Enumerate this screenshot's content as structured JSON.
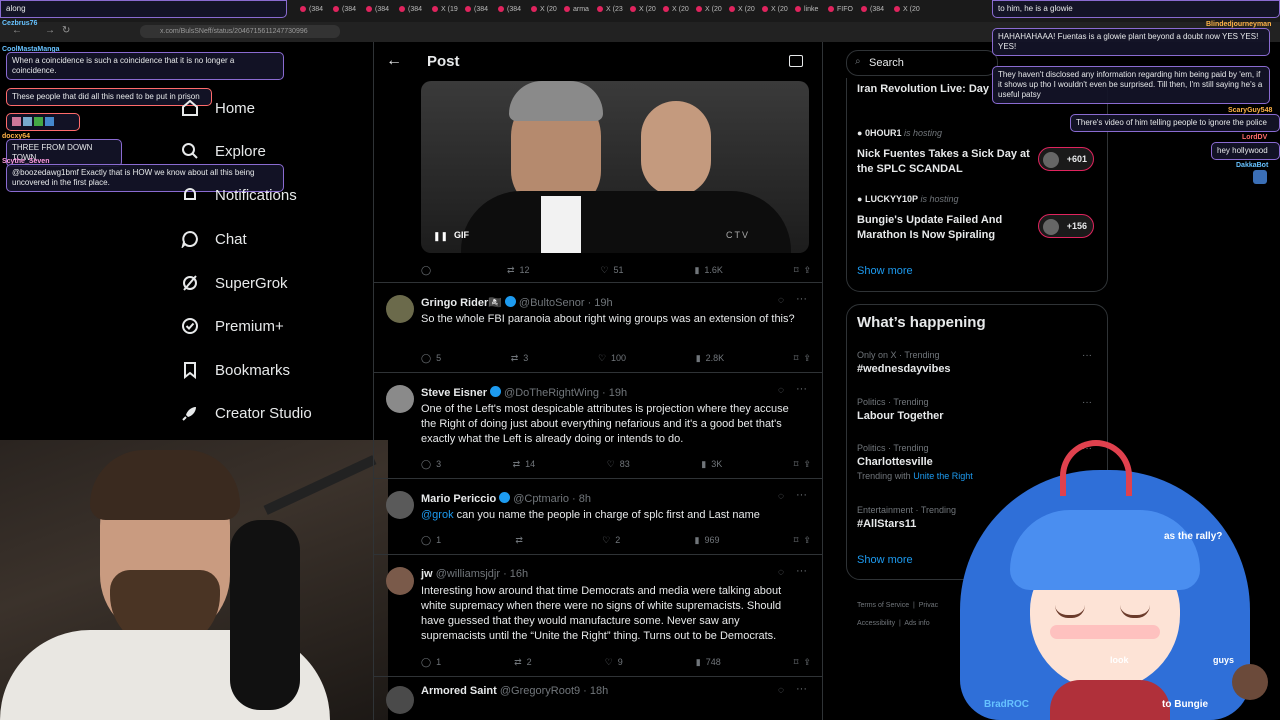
{
  "browser": {
    "url": "x.com/BulsSNeff/status/2046715611247730996",
    "tabs": [
      "(384",
      "(384",
      "(384",
      "(384",
      "X (19",
      "(384",
      "(384",
      "X (20",
      "arma",
      "X (23",
      "X (20",
      "X (20",
      "X (20",
      "X (20",
      "X (20",
      "linke",
      "FIFO",
      "(384",
      "X (20"
    ]
  },
  "chat_left": [
    {
      "user": "",
      "text": "along",
      "color": "#fff"
    },
    {
      "user": "Cezbrus76",
      "text": "",
      "color": "#66c2ff"
    },
    {
      "user": "CoolMastaManga",
      "text": "When a coincidence is such a coincidence that it is no longer a coincidence.",
      "color": "#66c2ff"
    },
    {
      "user": "",
      "text": "These people that did all this need to be put in prison",
      "color": "#ff6b6b"
    },
    {
      "user": "",
      "text": "",
      "color": "#ff6b6b"
    },
    {
      "user": "docxy64",
      "text": "THREE FROM DOWN TOWN",
      "color": "#ffb347"
    },
    {
      "user": "Scythe_Seven",
      "text": "@boozedawg1bmf Exactly that is HOW we know about all this being uncovered in the first place.",
      "color": "#ff9be0"
    }
  ],
  "nav": {
    "home": "Home",
    "explore": "Explore",
    "notifications": "Notifications",
    "chat": "Chat",
    "supergrok": "SuperGrok",
    "premium": "Premium+",
    "bookmarks": "Bookmarks",
    "creator": "Creator Studio"
  },
  "header": {
    "title": "Post"
  },
  "media": {
    "badge": "GIF",
    "watermark": "CTV"
  },
  "media_actions": {
    "replies": "",
    "reposts": "12",
    "likes": "51",
    "views": "1.6K"
  },
  "posts": [
    {
      "name": "Gringo Rider🏴‍☠️",
      "handle": "@BultoSenor · 19h",
      "text": "So the whole FBI paranoia about right wing groups was an extension of this?",
      "replies": "5",
      "reposts": "3",
      "likes": "100",
      "views": "2.8K"
    },
    {
      "name": "Steve Eisner",
      "handle": "@DoTheRightWing · 19h",
      "text": "One of the Left's most despicable attributes is  projection where they accuse the Right of doing just about everything nefarious and it's a good bet that's exactly what the Left is already doing or intends to do.",
      "replies": "3",
      "reposts": "14",
      "likes": "83",
      "views": "3K"
    },
    {
      "name": "Mario Periccio",
      "handle": "@Cptmario · 8h",
      "mention": "@grok",
      "text": " can you name the people in charge of splc first and Last name",
      "replies": "1",
      "reposts": "",
      "likes": "2",
      "views": "969"
    },
    {
      "name": "jw",
      "handle": "@williamsjdjr · 16h",
      "text": "Interesting how around that time Democrats and media were talking about white supremacy when there were no signs of white supremacists. Should have guessed that they would manufacture some. Never saw any supremacists until the “Unite the Right” thing. Turns out to be Democrats.",
      "replies": "1",
      "reposts": "2",
      "likes": "9",
      "views": "748"
    },
    {
      "name": "Armored Saint",
      "handle": "@GregoryRoot9 · 18h"
    }
  ],
  "search": {
    "placeholder": "Search"
  },
  "live": [
    {
      "title": "Iran Revolution Live: Day",
      "host": "",
      "count": ""
    },
    {
      "host": "0HOUR1",
      "hosting": "is hosting",
      "title": "Nick Fuentes Takes a Sick Day at the SPLC SCANDAL",
      "count": "+601"
    },
    {
      "host": "LUCKYY10P",
      "hosting": "is hosting",
      "title": "Bungie's Update Failed And Marathon Is Now Spiraling",
      "count": "+156"
    }
  ],
  "show_more": "Show more",
  "happening": {
    "title": "What’s happening",
    "trends": [
      {
        "cat": "Only on X · Trending",
        "name": "#wednesdayvibes",
        "extra": ""
      },
      {
        "cat": "Politics · Trending",
        "name": "Labour Together",
        "extra": ""
      },
      {
        "cat": "Politics · Trending",
        "name": "Charlottesville",
        "extra_prefix": "Trending with ",
        "extra": "Unite the Right"
      },
      {
        "cat": "Entertainment · Trending",
        "name": "#AllStars11",
        "extra": ""
      }
    ],
    "show_more": "Show more"
  },
  "footer": {
    "terms": "Terms of Service",
    "privacy": "Privac",
    "access": "Accessibility",
    "ads": "Ads info"
  },
  "chat_right": [
    {
      "text": "to him, he is a glowie"
    },
    {
      "user": "Blindedjourneyman",
      "text": "HAHAHAHAAA! Fuentas is a glowie plant beyond a doubt now YES YES! YES!"
    },
    {
      "text": "They haven't disclosed any information regarding him being paid by 'em, if it shows up tho I wouldn't even be surprised. Till then, I'm still saying he's a useful patsy"
    },
    {
      "user": "ScaryGuy548",
      "text": "There's video of him telling people to ignore the police"
    },
    {
      "user": "LordDV",
      "text": "hey hollywood"
    },
    {
      "user": "DakkaBot",
      "text": ""
    }
  ],
  "overlay_text": {
    "rally": "as the rally?",
    "bungie": "to Bungie",
    "bottom_user": "BradROC",
    "look": "look",
    "guys": "guys"
  }
}
